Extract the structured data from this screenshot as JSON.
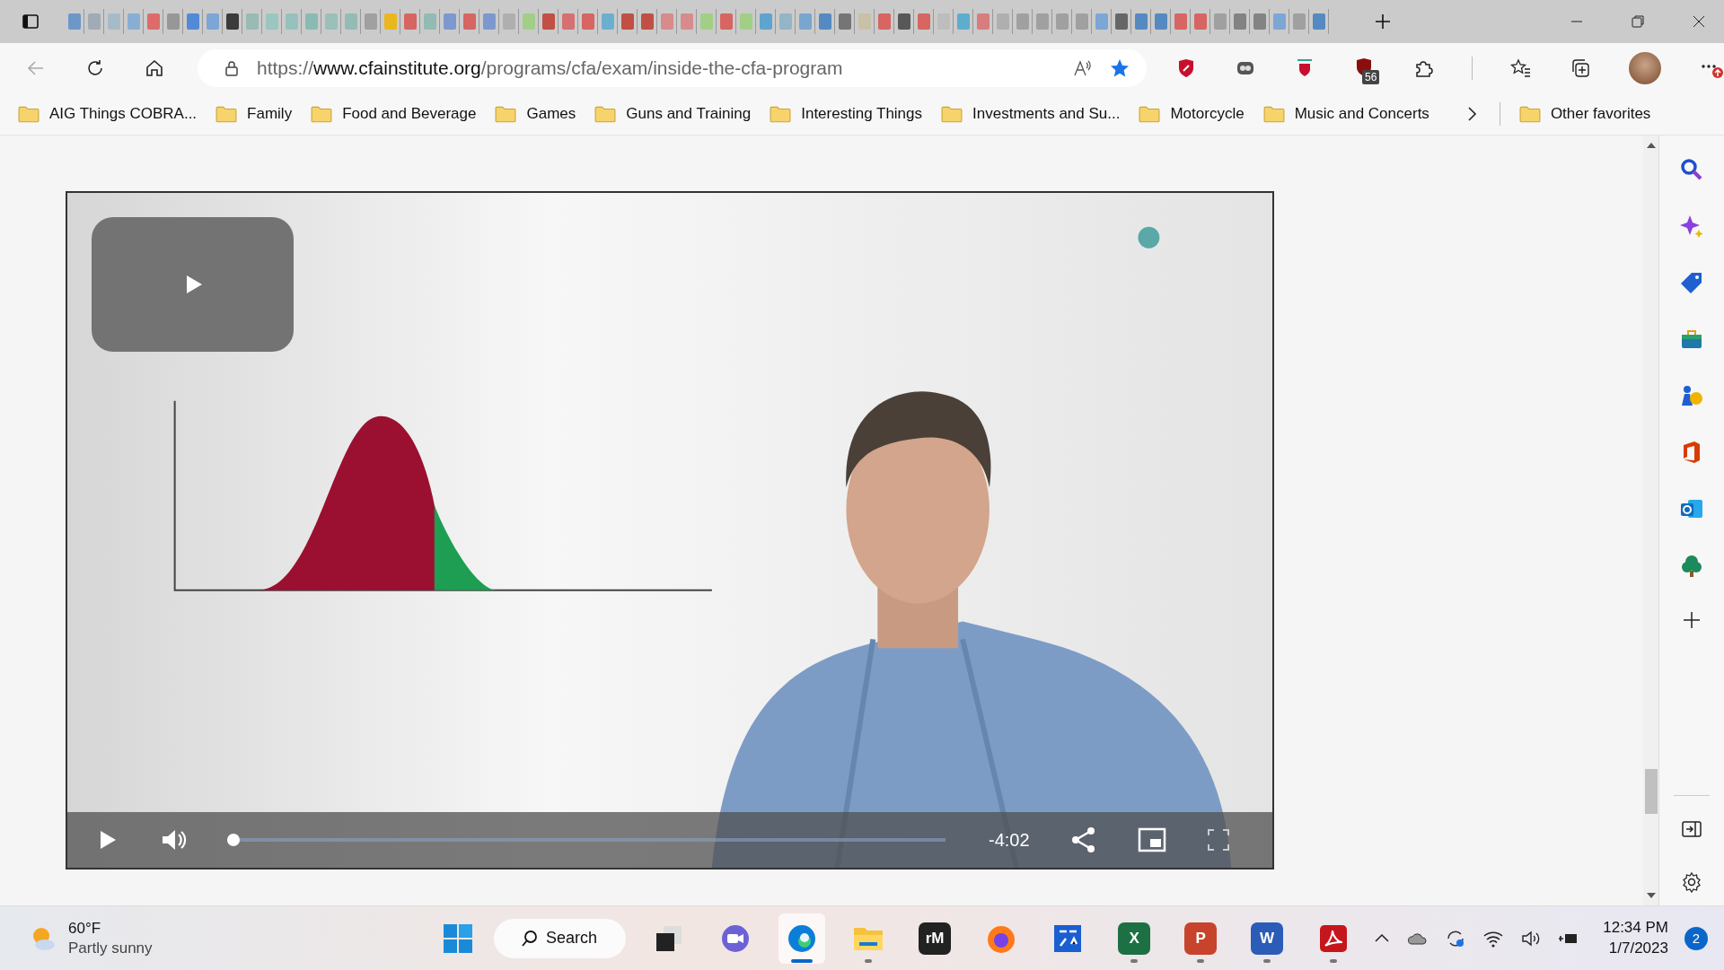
{
  "browser": {
    "url": {
      "scheme": "https://",
      "host": "www.cfainstitute.org",
      "path": "/programs/cfa/exam/inside-the-cfa-program"
    },
    "extension_badge": "56",
    "favorites": [
      {
        "label": "AIG Things COBRA..."
      },
      {
        "label": "Family"
      },
      {
        "label": "Food and Beverage"
      },
      {
        "label": "Games"
      },
      {
        "label": "Guns and Training"
      },
      {
        "label": "Interesting Things"
      },
      {
        "label": "Investments and Su..."
      },
      {
        "label": "Motorcycle"
      },
      {
        "label": "Music and Concerts"
      }
    ],
    "other_favorites": "Other favorites"
  },
  "video": {
    "kind": "picture",
    "progress": {
      "level": 0
    },
    "time": "-4:02"
  },
  "taskbar": {
    "weather": {
      "temperature": "60°F",
      "condition": "Partly sunny"
    },
    "search": "Search",
    "apps": [
      {
        "kind": "taskview",
        "running": false,
        "active": false
      },
      {
        "kind": "chat",
        "running": false,
        "active": false
      },
      {
        "kind": "edge",
        "running": true,
        "active": true
      },
      {
        "kind": "explorer",
        "running": true,
        "active": false
      },
      {
        "kind": "letter",
        "glyph": "rM",
        "color": "#222222",
        "running": false,
        "active": false
      },
      {
        "kind": "firefox",
        "running": false,
        "active": false
      },
      {
        "kind": "tools",
        "running": false,
        "active": false
      },
      {
        "kind": "letter",
        "glyph": "X",
        "color": "#1d7044",
        "running": true,
        "active": false
      },
      {
        "kind": "letter",
        "glyph": "P",
        "color": "#c8432b",
        "running": true,
        "active": false
      },
      {
        "kind": "letter",
        "glyph": "W",
        "color": "#2b5cb8",
        "running": true,
        "active": false
      },
      {
        "kind": "acrobat",
        "running": true,
        "active": false
      }
    ],
    "clock": {
      "time": "12:34 PM",
      "date": "1/7/2023"
    },
    "notifications": "2"
  }
}
